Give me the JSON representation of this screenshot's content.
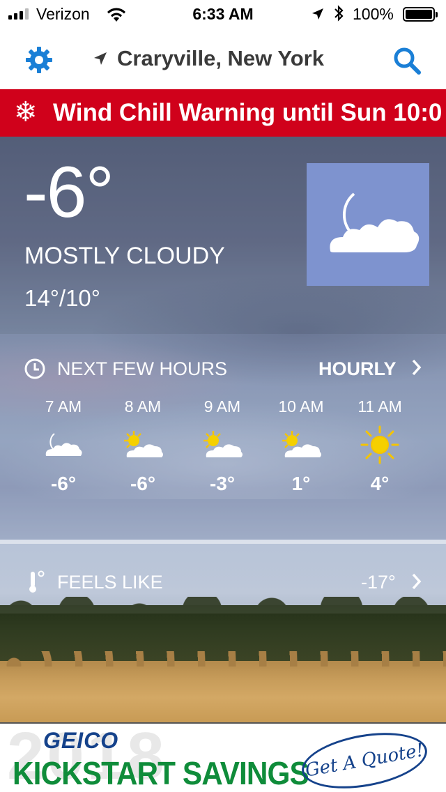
{
  "status_bar": {
    "carrier": "Verizon",
    "time": "6:33 AM",
    "battery_percent": "100%",
    "signal_bars": 3,
    "icons": [
      "signal-icon",
      "wifi-icon",
      "location-arrow-icon",
      "bluetooth-icon",
      "battery-icon"
    ]
  },
  "nav": {
    "location": "Craryville, New York",
    "icons": [
      "gear-icon",
      "location-arrow-icon",
      "search-icon"
    ],
    "accent_color": "#1a7fd6"
  },
  "alert": {
    "text": "Wind Chill Warning until Sun 10:0",
    "icon": "snowflake-icon",
    "color": "#d0011b"
  },
  "current": {
    "temperature": "-6°",
    "condition": "MOSTLY CLOUDY",
    "hi_lo": "14°/10°",
    "icon": "moon-cloud-icon"
  },
  "hours": {
    "title": "NEXT FEW HOURS",
    "link": "HOURLY",
    "items": [
      {
        "time": "7 AM",
        "temp": "-6°",
        "icon": "moon-cloud-icon"
      },
      {
        "time": "8 AM",
        "temp": "-6°",
        "icon": "sun-cloud-icon"
      },
      {
        "time": "9 AM",
        "temp": "-3°",
        "icon": "sun-cloud-icon"
      },
      {
        "time": "10 AM",
        "temp": "1°",
        "icon": "sun-cloud-icon"
      },
      {
        "time": "11 AM",
        "temp": "4°",
        "icon": "sun-icon"
      }
    ]
  },
  "feels_like": {
    "label": "FEELS LIKE",
    "value": "-17°",
    "icon": "thermometer-icon"
  },
  "ad": {
    "watermark": "2018",
    "brand": "GEICO",
    "tagline": "KICKSTART SAVINGS",
    "cta": "Get A Quote!"
  }
}
